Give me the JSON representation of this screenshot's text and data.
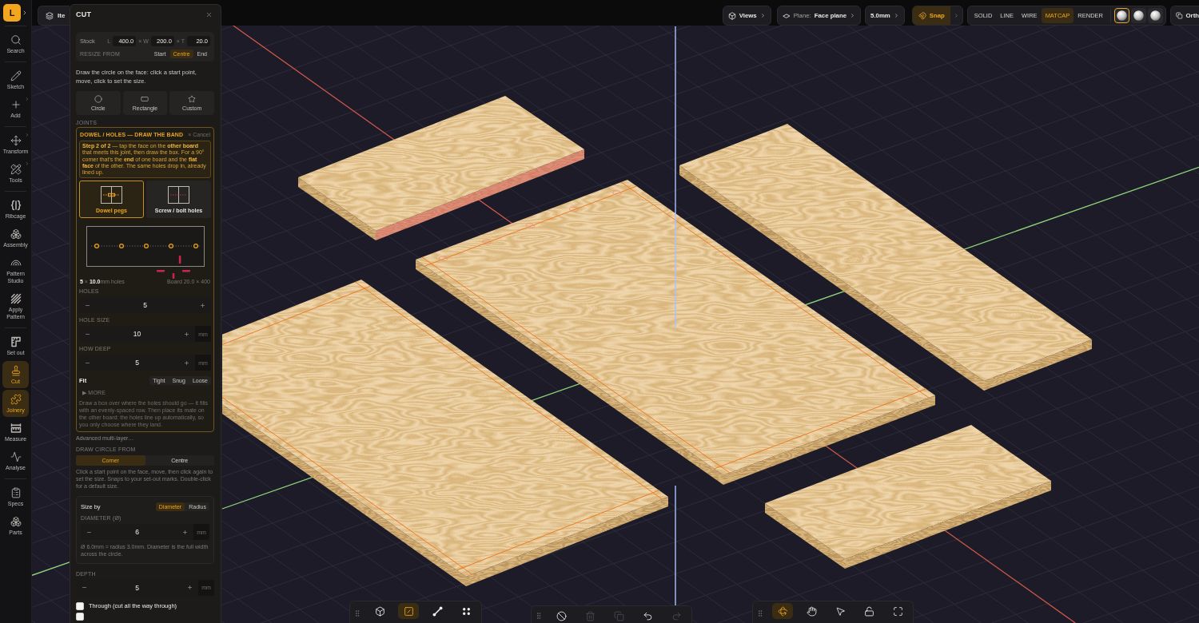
{
  "rail": {
    "logo": "L",
    "groups": [
      {
        "items": [
          {
            "label": "Search",
            "selected": false,
            "submenu": false
          }
        ]
      },
      {
        "items": [
          {
            "label": "Sketch",
            "selected": false,
            "submenu": false
          },
          {
            "label": "Add",
            "selected": false,
            "submenu": true
          }
        ]
      },
      {
        "items": [
          {
            "label": "Transform",
            "selected": false,
            "submenu": true
          },
          {
            "label": "Tools",
            "selected": false,
            "submenu": true
          }
        ]
      },
      {
        "items": [
          {
            "label": "Ribcage",
            "selected": false,
            "submenu": false
          },
          {
            "label": "Assembly",
            "selected": false,
            "submenu": false
          },
          {
            "label": "Pattern Studio",
            "selected": false,
            "submenu": false
          },
          {
            "label": "Apply Pattern",
            "selected": false,
            "submenu": false
          }
        ]
      },
      {
        "items": [
          {
            "label": "Set out",
            "selected": false,
            "submenu": false
          },
          {
            "label": "Cut",
            "selected": true,
            "submenu": false
          },
          {
            "label": "Joinery",
            "selected": true,
            "submenu": false
          },
          {
            "label": "Measure",
            "selected": false,
            "submenu": false
          },
          {
            "label": "Analyse",
            "selected": false,
            "submenu": false
          }
        ]
      },
      {
        "items": [
          {
            "label": "Specs",
            "selected": false,
            "submenu": false
          },
          {
            "label": "Parts",
            "selected": false,
            "submenu": false
          }
        ]
      }
    ]
  },
  "tab": {
    "label": "Ite"
  },
  "panel": {
    "title": "CUT",
    "stock": {
      "label": "Stock",
      "dims": [
        {
          "prefix": "L",
          "value": "400.0"
        },
        {
          "prefix": "× W",
          "value": "200.0"
        },
        {
          "prefix": "× T",
          "value": "20.0"
        }
      ],
      "resize_label": "RESIZE FROM",
      "resize_options": [
        {
          "label": "Start",
          "selected": false
        },
        {
          "label": "Centre",
          "selected": true
        },
        {
          "label": "End",
          "selected": false
        }
      ]
    },
    "instruction": "Draw the circle on the face: click a start point, move, click to set the size.",
    "shapes": [
      {
        "label": "Circle",
        "selected": false
      },
      {
        "label": "Rectangle",
        "selected": false
      },
      {
        "label": "Custom",
        "selected": false
      }
    ],
    "joints_heading": "JOINTS",
    "joint": {
      "title": "DOWEL / HOLES — DRAW THE BAND",
      "cancel": "× Cancel",
      "step": "**Step 2 of 2** — tap the face on the **other board** that meets this joint, then draw the box. For a 90° corner that's the **end** of one board and the **flat face** of the other. The same holes drop in, already lined up.",
      "types": [
        {
          "label": "Dowel pegs",
          "selected": true
        },
        {
          "label": "Screw / bolt holes",
          "selected": false
        }
      ],
      "summary": "**5** × **10.0**mm holes",
      "board": "Board 20.0 × 400",
      "fields": [
        {
          "label": "HOLES",
          "value": "5"
        },
        {
          "label": "HOLE SIZE",
          "value": "10",
          "unit": "mm"
        },
        {
          "label": "HOW DEEP",
          "value": "5",
          "unit": "mm"
        }
      ],
      "fit": {
        "label": "Fit",
        "options": [
          {
            "label": "Tight",
            "selected": false
          },
          {
            "label": "Snug",
            "selected": false
          },
          {
            "label": "Loose",
            "selected": false
          }
        ]
      },
      "more": "▶ MORE",
      "help": "Draw a box over where the holes should go — it fills with an evenly-spaced row. Then place its mate on the other board: the holes line up automatically, so you only choose where they land."
    },
    "advanced": "Advanced multi-layer…",
    "draw_from": {
      "label": "DRAW CIRCLE FROM",
      "options": [
        {
          "label": "Corner",
          "selected": true
        },
        {
          "label": "Centre",
          "selected": false
        }
      ],
      "help": "Click a start point on the face, move, then click again to set the size. Snaps to your set-out marks. Double-click for a default size."
    },
    "size": {
      "label": "Size by",
      "options": [
        {
          "label": "Diameter",
          "selected": true
        },
        {
          "label": "Radius",
          "selected": false
        }
      ],
      "field": {
        "label": "DIAMETER (Ø)",
        "value": "6",
        "unit": "mm"
      },
      "note": "Ø 6.0mm = radius 3.0mm. Diameter is the full width across the circle."
    },
    "depth": {
      "label": "DEPTH",
      "value": "5",
      "unit": "mm"
    },
    "checkboxes": [
      {
        "label": "Through (cut all the way through)",
        "checked": false
      },
      {
        "checked": false
      }
    ]
  },
  "topbar": {
    "views": "Views",
    "plane": {
      "prefix": "Plane:",
      "value": "Face plane"
    },
    "grid": "5.0mm",
    "snap": {
      "label": "Snap",
      "on": true
    },
    "modes": [
      {
        "label": "SOLID",
        "selected": false
      },
      {
        "label": "LINE",
        "selected": false
      },
      {
        "label": "WIRE",
        "selected": false
      },
      {
        "label": "MATCAP",
        "selected": true
      },
      {
        "label": "RENDER",
        "selected": false
      }
    ],
    "materials": [
      {
        "selected": true
      },
      {
        "selected": false
      },
      {
        "selected": false
      }
    ],
    "ortho": "Orth"
  },
  "toolbars": [
    {
      "tools": [
        {
          "selected": false,
          "disabled": false
        },
        {
          "selected": true,
          "disabled": false
        },
        {
          "selected": false,
          "disabled": false
        },
        {
          "selected": false,
          "disabled": false
        }
      ]
    },
    {
      "tools": [
        {
          "selected": false,
          "disabled": false
        },
        {
          "selected": false,
          "disabled": true
        },
        {
          "selected": false,
          "disabled": true
        },
        {
          "selected": false,
          "disabled": false
        },
        {
          "selected": false,
          "disabled": true
        }
      ]
    },
    {
      "tools": [
        {
          "selected": true,
          "disabled": false
        },
        {
          "selected": false,
          "disabled": false
        },
        {
          "selected": false,
          "disabled": false
        },
        {
          "selected": false,
          "disabled": false
        },
        {
          "selected": false,
          "disabled": false
        }
      ]
    }
  ],
  "scene": {
    "boards": [
      {
        "highlighted": true,
        "outlined": false,
        "drilled": false
      },
      {
        "highlighted": false,
        "outlined": true,
        "drilled": true
      },
      {
        "highlighted": false,
        "outlined": false,
        "drilled": false
      },
      {
        "highlighted": false,
        "outlined": true,
        "drilled": false
      },
      {
        "highlighted": false,
        "outlined": false,
        "drilled": false
      }
    ]
  }
}
